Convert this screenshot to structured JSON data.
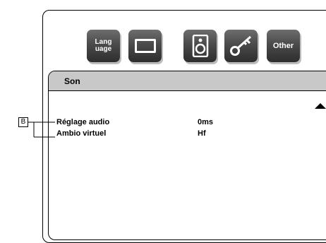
{
  "toolbar": {
    "language_label": "Lang\nuage",
    "other_label": "Other"
  },
  "panel": {
    "title": "Son"
  },
  "settings": [
    {
      "label": "Réglage audio",
      "value": "0ms"
    },
    {
      "label": "Ambio virtuel",
      "value": "Hf"
    }
  ],
  "callout": {
    "marker": "B"
  }
}
